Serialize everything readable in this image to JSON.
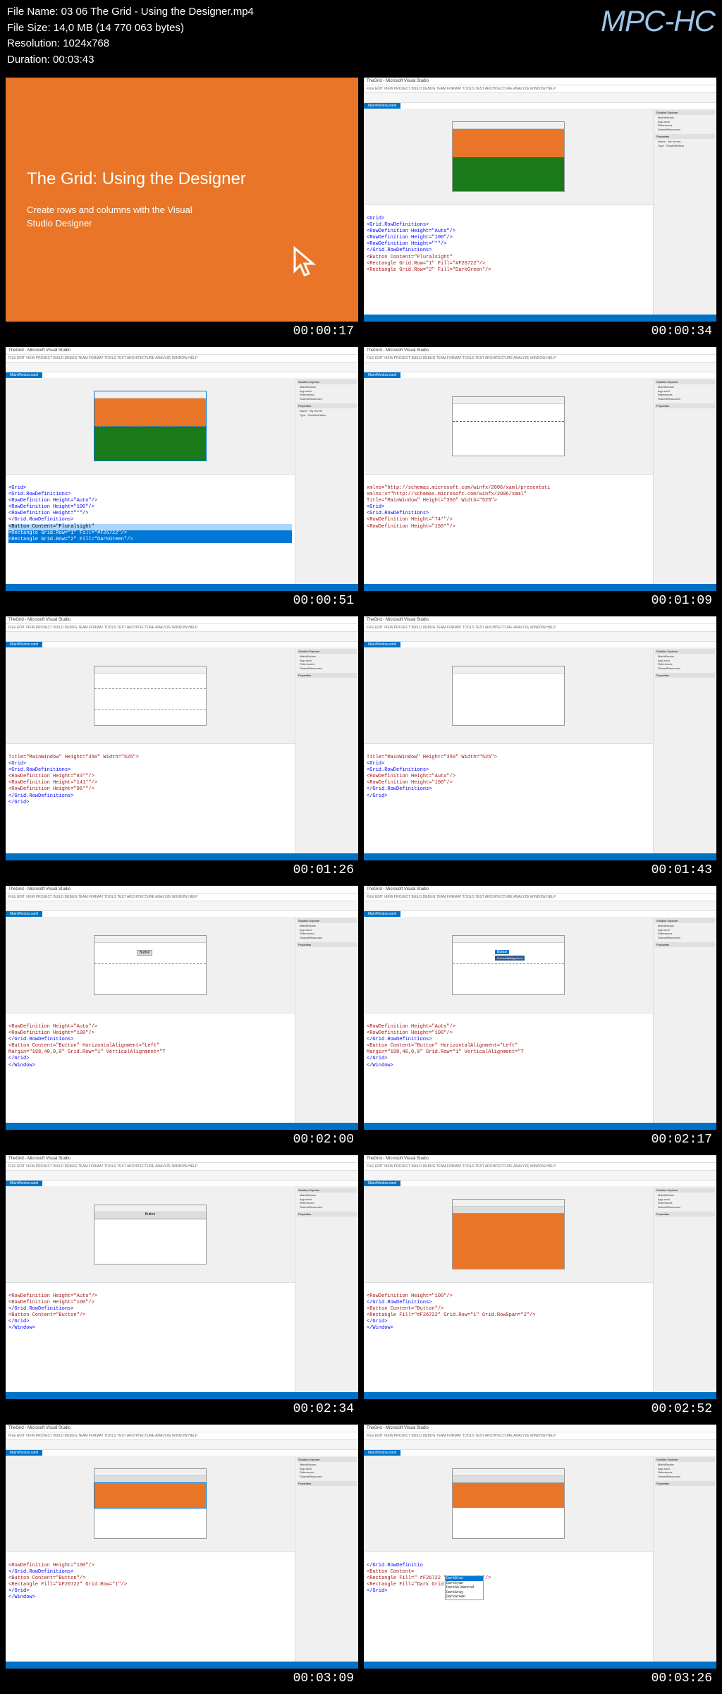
{
  "header": {
    "file_name": "File Name: 03 06 The Grid - Using the Designer.mp4",
    "file_size": "File Size: 14,0 MB (14 770 063 bytes)",
    "resolution": "Resolution: 1024x768",
    "duration": "Duration: 00:03:43",
    "logo": "MPC-HC"
  },
  "timestamps": [
    "00:00:17",
    "00:00:34",
    "00:00:51",
    "00:01:09",
    "00:01:26",
    "00:01:43",
    "00:02:00",
    "00:02:17",
    "00:02:34",
    "00:02:52",
    "00:03:09",
    "00:03:26"
  ],
  "slide": {
    "title": "The Grid: Using the Designer",
    "subtitle": "Create rows and columns with the Visual Studio Designer"
  },
  "vs": {
    "title": "TheGrid - Microsoft Visual Studio",
    "menu": "FILE  EDIT  VIEW  PROJECT  BUILD  DEBUG  TEAM  FORMAT  TOOLS  TEST  ARCHITECTURE  ANALYZE  WINDOW  HELP",
    "tab": "MainWindow.xaml",
    "solution_header": "Solution Explorer",
    "solution_items": [
      "MainWindow",
      "App.xaml",
      "References",
      "SharedResources"
    ],
    "props_header": "Properties",
    "server": "Name  ·  My Server",
    "type": "Type  ·  RowDefinition"
  },
  "code": {
    "f2_l1": "<Grid>",
    "f2_l2": "    <Grid.RowDefinitions>",
    "f2_l3": "        <RowDefinition Height=\"Auto\"/>",
    "f2_l4": "        <RowDefinition Height=\"100\"/>",
    "f2_l5": "        <RowDefinition Height=\"*\"/>",
    "f2_l6": "    </Grid.RowDefinitions>",
    "f2_l7": "    <Button Content=\"Pluralsight\"",
    "f2_l8": "    <Rectangle Grid.Row=\"1\" Fill=\"#F26722\"/>",
    "f2_l9": "    <Rectangle Grid.Row=\"2\" Fill=\"DarkGreen\"/>",
    "f4_l1": "    xmlns=\"http://schemas.microsoft.com/winfx/2006/xaml/presentati",
    "f4_l2": "    xmlns:x=\"http://schemas.microsoft.com/winfx/2006/xaml\"",
    "f4_l3": "    Title=\"MainWindow\" Height=\"350\" Width=\"525\">",
    "f4_l4": "<Grid>",
    "f4_l5": "    <Grid.RowDefinitions>",
    "f4_l6": "        <RowDefinition Height=\"74*\"/>",
    "f4_l7": "        <RowDefinition Height=\"150*\"/>",
    "f5_l1": "    Title=\"MainWindow\" Height=\"350\" Width=\"525\">",
    "f5_l2": "<Grid>",
    "f5_l3": "    <Grid.RowDefinitions>",
    "f5_l4": "        <RowDefinition Height=\"83*\"/>",
    "f5_l5": "        <RowDefinition Height=\"141*\"/>",
    "f5_l6": "        <RowDefinition Height=\"96*\"/>",
    "f5_l7": "    </Grid.RowDefinitions>",
    "f5_l8": "</Grid>",
    "f6_l1": "    Title=\"MainWindow\" Height=\"350\" Width=\"525\">",
    "f6_l2": "<Grid>",
    "f6_l3": "    <Grid.RowDefinitions>",
    "f6_l4": "        <RowDefinition Height=\"Auto\"/>",
    "f6_l5": "        <RowDefinition Height=\"100\"/>",
    "f6_l6": "    </Grid.RowDefinitions>",
    "f6_l7": "</Grid>",
    "f7_l1": "        <RowDefinition Height=\"Auto\"/>",
    "f7_l2": "        <RowDefinition Height=\"100\"/>",
    "f7_l3": "    </Grid.RowDefinitions>",
    "f7_l4": "    <Button Content=\"Button\" HorizontalAlignment=\"Left\"",
    "f7_l5": "        Margin=\"198,40,0,0\" Grid.Row=\"1\" VerticalAlignment=\"T",
    "f7_l6": "</Grid>",
    "f7_l7": "</Window>",
    "f9_l1": "        <RowDefinition Height=\"Auto\"/>",
    "f9_l2": "        <RowDefinition Height=\"100\"/>",
    "f9_l3": "    </Grid.RowDefinitions>",
    "f9_l4": "    <Button Content=\"Button\"/>",
    "f9_l5": "</Grid>",
    "f9_l6": "</Window>",
    "f10_l1": "        <RowDefinition Height=\"100\"/>",
    "f10_l2": "    </Grid.RowDefinitions>",
    "f10_l3": "    <Button Content=\"Button\"/>",
    "f10_l4": "    <Rectangle Fill=\"#F26722\" Grid.Row=\"1\" Grid.RowSpan=\"2\"/>",
    "f10_l5": "</Grid>",
    "f10_l6": "</Window>",
    "f11_l1": "        <RowDefinition Height=\"100\"/>",
    "f11_l2": "    </Grid.RowDefinitions>",
    "f11_l3": "    <Button Content=\"Button\"/>",
    "f11_l4": "    <Rectangle Fill=\"#F26722\" Grid.Row=\"1\"/>",
    "f11_l5": "</Grid>",
    "f11_l6": "</Window>",
    "f12_l1": "    </Grid.RowDefinitio",
    "f12_l2": "    <Button Content=",
    "f12_l3": "    <Rectangle Fill=\" #F26722 \" Grid.Row=\"1\"/>",
    "f12_l4": "    <Rectangle Fill=\"Dark  Grid.Row=\"2\"/>",
    "f12_l5": "</Grid>"
  },
  "intellisense": [
    "DarkBlue",
    "DarkCyan",
    "DarkGoldenrod",
    "DarkGray",
    "DarkGreen"
  ]
}
